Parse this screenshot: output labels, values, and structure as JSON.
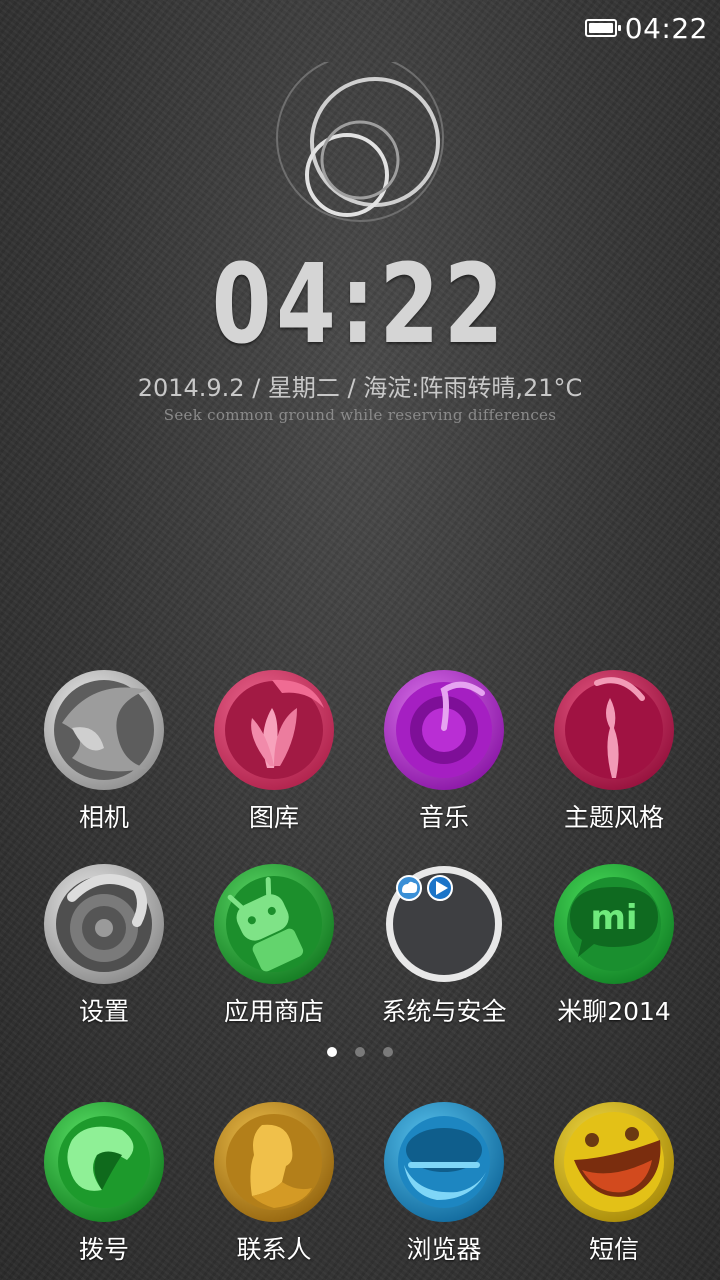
{
  "status_bar": {
    "time": "04:22",
    "battery_icon": "battery-full-icon"
  },
  "widget": {
    "time": "04:22",
    "date_line": "2014.9.2  / 星期二 / 海淀:阵雨转晴,21°C",
    "motto": "Seek common ground while reserving differences"
  },
  "apps": [
    {
      "label": "相机",
      "icon": "camera-icon"
    },
    {
      "label": "图库",
      "icon": "gallery-icon"
    },
    {
      "label": "音乐",
      "icon": "music-icon"
    },
    {
      "label": "主题风格",
      "icon": "theme-icon"
    },
    {
      "label": "设置",
      "icon": "settings-icon"
    },
    {
      "label": "应用商店",
      "icon": "app-store-icon"
    },
    {
      "label": "系统与安全",
      "icon": "security-folder-icon"
    },
    {
      "label": "米聊2014",
      "icon": "miliao-icon"
    }
  ],
  "page_indicator": {
    "count": 3,
    "active": 0
  },
  "dock": [
    {
      "label": "拨号",
      "icon": "phone-icon"
    },
    {
      "label": "联系人",
      "icon": "contacts-icon"
    },
    {
      "label": "浏览器",
      "icon": "browser-icon"
    },
    {
      "label": "短信",
      "icon": "messages-icon"
    }
  ],
  "colors": {
    "camera": "#cfcfcf",
    "gallery": "#d9456f",
    "music": "#b52ad0",
    "theme": "#c2184e",
    "settings": "#bdbdbd",
    "store": "#27b53a",
    "miliao": "#2bb34a",
    "phone": "#2fbf39",
    "contacts": "#d9a22a",
    "browser": "#2aa6df",
    "messages": "#e9c514"
  }
}
